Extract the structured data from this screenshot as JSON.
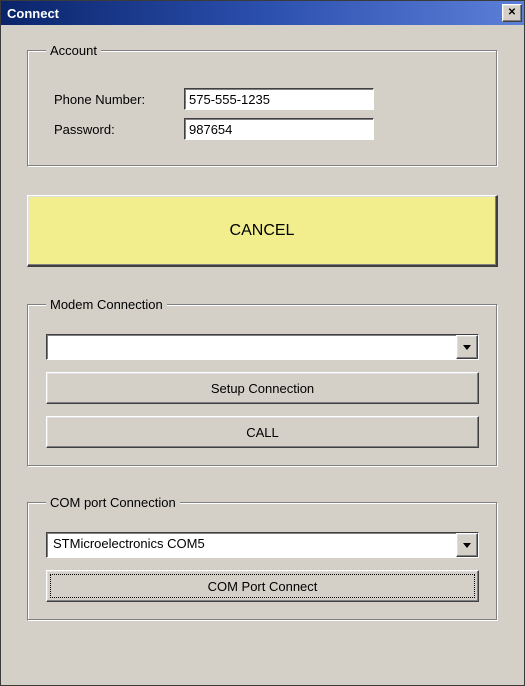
{
  "window": {
    "title": "Connect"
  },
  "account": {
    "legend": "Account",
    "phone_label": "Phone Number:",
    "phone_value": "575-555-1235",
    "password_label": "Password:",
    "password_value": "987654"
  },
  "cancel_label": "CANCEL",
  "modem": {
    "legend": "Modem Connection",
    "selected": "",
    "setup_label": "Setup Connection",
    "call_label": "CALL"
  },
  "com": {
    "legend": "COM port Connection",
    "selected": "STMicroelectronics COM5",
    "connect_label": "COM Port Connect"
  }
}
